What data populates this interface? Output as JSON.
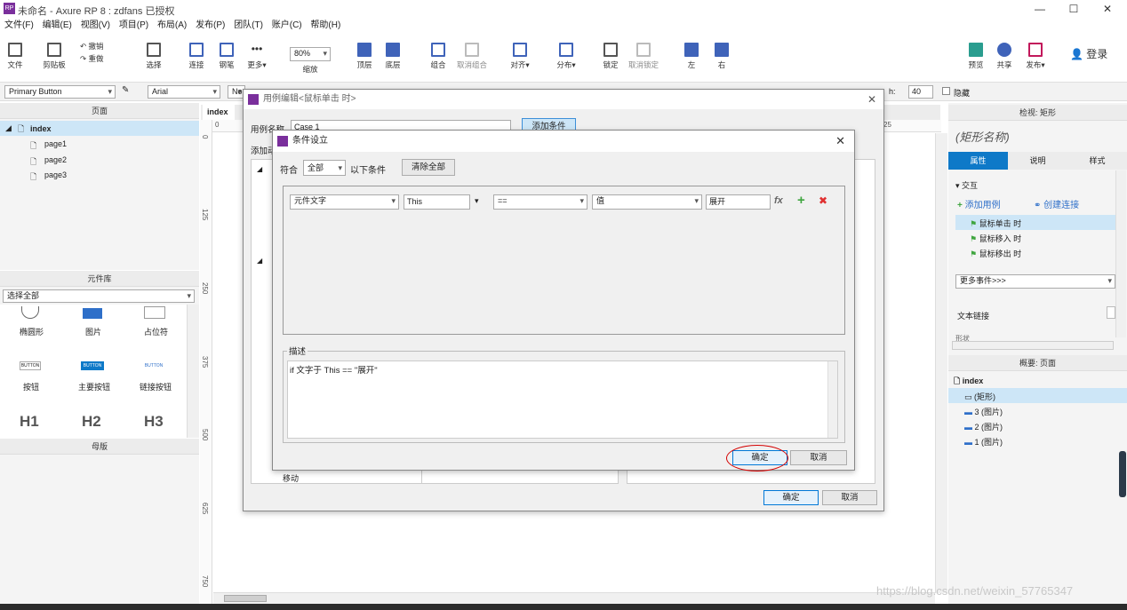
{
  "app": {
    "title": "未命名 - Axure RP 8 : zdfans 已授权",
    "logo": "RP"
  },
  "window_controls": {
    "minimize": "—",
    "maximize": "☐",
    "close": "✕"
  },
  "menu": [
    "文件(F)",
    "编辑(E)",
    "视图(V)",
    "项目(P)",
    "布局(A)",
    "发布(P)",
    "团队(T)",
    "账户(C)",
    "帮助(H)"
  ],
  "toolbar": {
    "file": "文件",
    "clipboard": "剪贴板",
    "undo": "撤销",
    "redo": "重做",
    "select": "选择",
    "connect": "连接",
    "pen": "钢笔",
    "more": "更多▾",
    "zoom_value": "80%",
    "zoom_label": "缩放",
    "top": "顶层",
    "bottom": "底层",
    "group": "组合",
    "ungroup": "取消组合",
    "align": "对齐▾",
    "distribute": "分布▾",
    "lock": "锁定",
    "unlock": "取消锁定",
    "left": "左",
    "right": "右",
    "preview": "预览",
    "share": "共享",
    "publish": "发布▾",
    "login": "登录"
  },
  "format": {
    "style": "Primary Button",
    "font": "Arial",
    "weight": "No",
    "h_label": "h:",
    "h_value": "40",
    "hidden": "隐藏"
  },
  "pages_panel": {
    "title": "页面",
    "root": "index",
    "pages": [
      "page1",
      "page2",
      "page3"
    ]
  },
  "library_panel": {
    "title": "元件库",
    "filter": "选择全部",
    "items": [
      {
        "label": "椭圆形"
      },
      {
        "label": "图片"
      },
      {
        "label": "占位符"
      },
      {
        "label": "按钮",
        "preview": "BUTTON"
      },
      {
        "label": "主要按钮",
        "preview": "BUTTON"
      },
      {
        "label": "链接按钮",
        "preview": "BUTTON"
      },
      {
        "label": "",
        "preview": "H1"
      },
      {
        "label": "",
        "preview": "H2"
      },
      {
        "label": "",
        "preview": "H3"
      }
    ]
  },
  "masters_panel": {
    "title": "母版"
  },
  "canvas_tab": "index",
  "ruler": {
    "h": [
      "0",
      "25"
    ],
    "v": [
      "0",
      "125",
      "250",
      "375",
      "500",
      "625",
      "750"
    ]
  },
  "case_editor": {
    "title": "用例编辑<鼠标单击 时>",
    "case_name_label": "用例名称",
    "case_name": "Case 1",
    "add_condition": "添加条件",
    "add_action_label": "添加动",
    "partial_rows": [
      "移动"
    ],
    "ok": "确定",
    "cancel": "取消"
  },
  "condition_dialog": {
    "title": "条件设立",
    "match_label": "符合",
    "match_value": "全部",
    "following": "以下条件",
    "clear_all": "清除全部",
    "row": {
      "field": "元件文字",
      "target": "This",
      "operator": "==",
      "value_type": "值",
      "value": "展开",
      "fx": "fx",
      "add": "+",
      "remove": "✖"
    },
    "desc_label": "描述",
    "desc_text": "if 文字于 This == \"展开\"",
    "ok": "确定",
    "cancel": "取消"
  },
  "inspector": {
    "title": "检视: 矩形",
    "name_placeholder": "(矩形名称)",
    "tabs": [
      "属性",
      "说明",
      "样式"
    ],
    "interaction": "交互",
    "add_case": "添加用例",
    "create_link": "创建连接",
    "events": [
      "鼠标单击 时",
      "鼠标移入 时",
      "鼠标移出 时"
    ],
    "more_events": "更多事件>>>",
    "text_link": "文本链接",
    "partial": "形状"
  },
  "outline": {
    "title": "概要: 页面",
    "root": "index",
    "items": [
      "(矩形)",
      "3 (图片)",
      "2 (图片)",
      "1 (图片)"
    ]
  },
  "watermark": "https://blog.csdn.net/weixin_57765347",
  "colors": {
    "accent": "#2e6fc9",
    "tab_active": "#0e79c8",
    "highlight": "#cde6f7",
    "annotation": "#d40000"
  }
}
